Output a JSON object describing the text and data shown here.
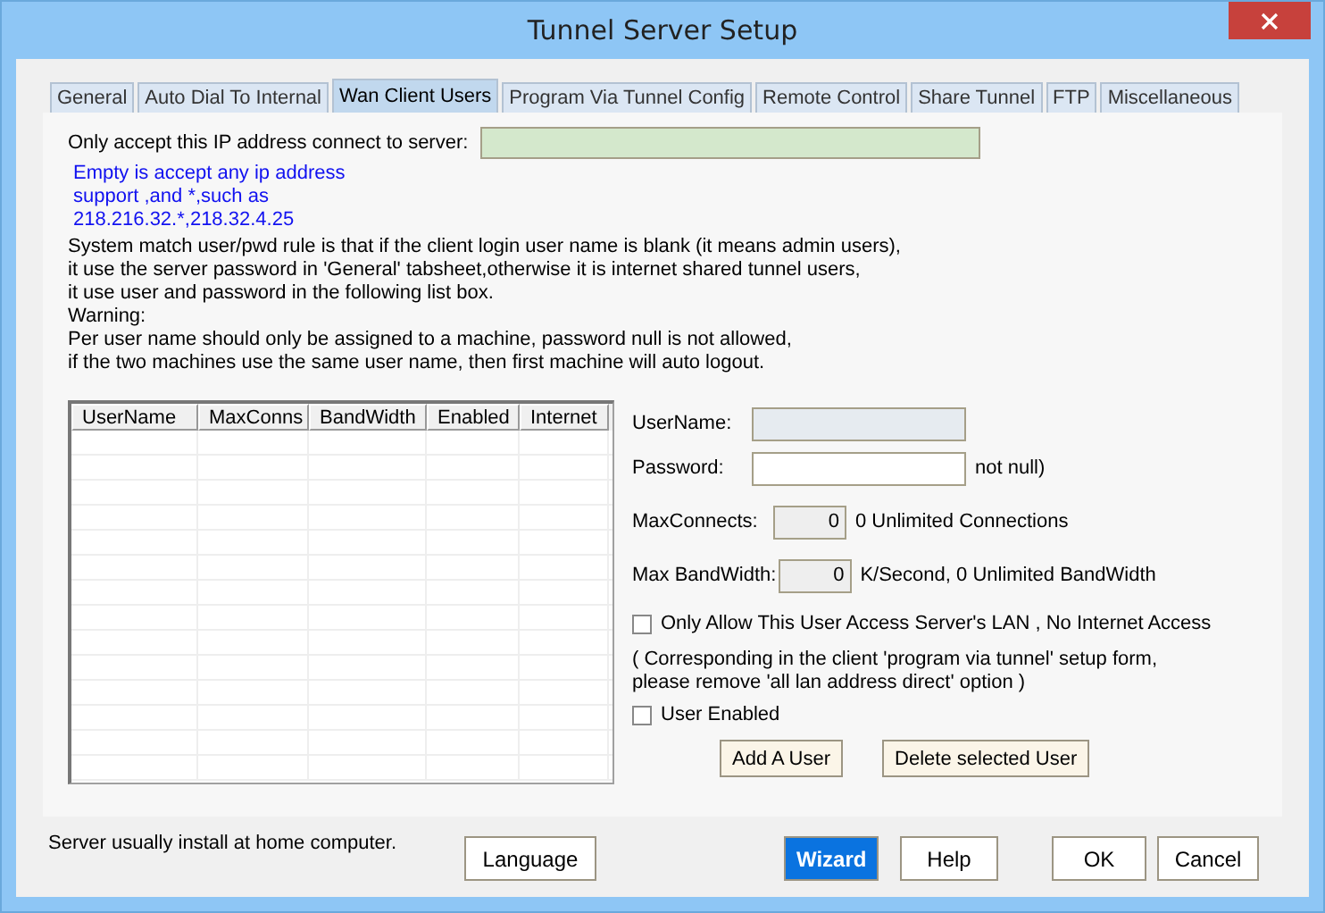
{
  "window": {
    "title": "Tunnel Server Setup"
  },
  "tabs": [
    {
      "label": "General",
      "selected": false
    },
    {
      "label": "Auto Dial To Internal",
      "selected": false
    },
    {
      "label": "Wan Client Users",
      "selected": true
    },
    {
      "label": "Program Via Tunnel Config",
      "selected": false
    },
    {
      "label": "Remote Control",
      "selected": false
    },
    {
      "label": "Share Tunnel",
      "selected": false
    },
    {
      "label": "FTP",
      "selected": false
    },
    {
      "label": "Miscellaneous",
      "selected": false
    }
  ],
  "ip_filter": {
    "label": "Only accept this IP address connect to server:"
  },
  "hints": [
    "Empty is accept any ip address",
    "support ,and *,such as",
    "218.216.32.*,218.32.4.25"
  ],
  "rules": [
    "System match user/pwd rule is that if the client login user name is blank (it means admin users),",
    "it use the server password in 'General' tabsheet,otherwise it is internet shared tunnel users,",
    "it use user and password in the following list box.",
    "Warning:",
    " Per user name should only be assigned to a machine, password null is not allowed,",
    " if the two machines use the same user name, then first machine will auto logout."
  ],
  "table": {
    "columns": [
      "UserName",
      "MaxConns",
      "BandWidth",
      "Enabled",
      "Internet"
    ]
  },
  "user_form": {
    "fields": [
      {
        "kind": "text",
        "label": "UserName:",
        "disabled": true
      },
      {
        "kind": "text",
        "label": "Password:",
        "disabled": false,
        "note": "not null)"
      },
      {
        "kind": "number",
        "label": "MaxConnects:",
        "value": "0",
        "note": "0 Unlimited Connections"
      },
      {
        "kind": "number",
        "label": "Max BandWidth:",
        "value": "0",
        "note": "K/Second, 0 Unlimited BandWidth"
      }
    ],
    "lan_only": {
      "label": "Only Allow This User Access Server's LAN , No Internet Access",
      "checked": false
    },
    "notes": [
      "( Corresponding in the client 'program via tunnel' setup form,",
      "please remove 'all lan address direct' option )"
    ],
    "enabled": {
      "label": "User Enabled",
      "checked": false
    },
    "buttons": [
      "Add A User",
      "Delete selected User"
    ]
  },
  "footer": {
    "note": "Server usually install at home computer.",
    "buttons": [
      {
        "label": "Language",
        "kind": "normal"
      },
      {
        "label": "Wizard",
        "kind": "primary"
      },
      {
        "label": "Help",
        "kind": "normal"
      },
      {
        "label": "OK",
        "kind": "normal"
      },
      {
        "label": "Cancel",
        "kind": "normal"
      }
    ]
  }
}
